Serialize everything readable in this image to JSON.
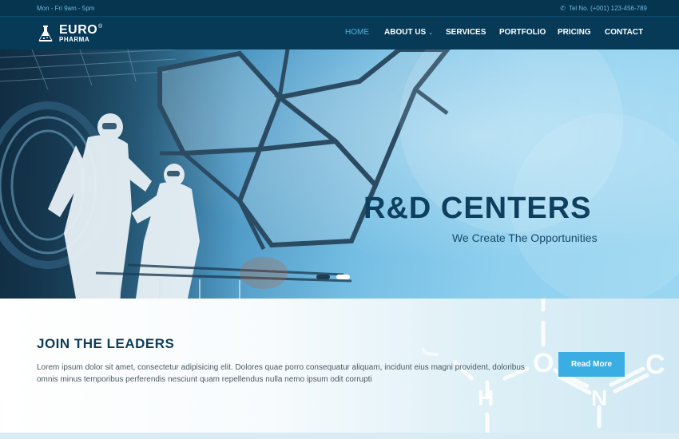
{
  "topbar": {
    "hours": "Mon - Fri 9am - 5pm",
    "phone_icon": "phone-icon",
    "phone": "Tel No. (+001) 123-456-789"
  },
  "brand": {
    "name": "EURO",
    "sub": "PHARMA",
    "registered": "®",
    "icon": "flask-icon"
  },
  "nav": {
    "items": [
      {
        "label": "HOME",
        "active": true
      },
      {
        "label": "ABOUT US",
        "dropdown": true
      },
      {
        "label": "SERVICES"
      },
      {
        "label": "PORTFOLIO"
      },
      {
        "label": "PRICING"
      },
      {
        "label": "CONTACT"
      }
    ],
    "caret": "⌄"
  },
  "hero": {
    "title": "R&D CENTERS",
    "subtitle": "We Create The Opportunities",
    "slides_total": 2,
    "active_slide": 1
  },
  "join": {
    "title": "JOIN THE LEADERS",
    "text": "Lorem ipsum dolor sit amet, consectetur adipisicing elit. Dolores quae porro consequatur aliquam, incidunt eius magni provident, doloribus omnis minus temporibus perferendis nesciunt quam repellendus nulla nemo ipsum odit corrupti",
    "button": "Read More",
    "molecule_letters": [
      "O",
      "C",
      "H",
      "N"
    ]
  },
  "colors": {
    "topbar": "#06354f",
    "navbar": "#073a57",
    "accent": "#3aaee3",
    "heading": "#0d3d5a"
  }
}
